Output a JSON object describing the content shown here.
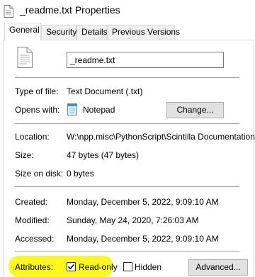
{
  "window": {
    "title": "_readme.txt Properties",
    "title_icon": "text-file-icon"
  },
  "tabs": [
    {
      "label": "General",
      "active": true
    },
    {
      "label": "Security",
      "active": false
    },
    {
      "label": "Details",
      "active": false
    },
    {
      "label": "Previous Versions",
      "active": false
    }
  ],
  "general": {
    "file_name": "_readme.txt",
    "type_label": "Type of file:",
    "type_value": "Text Document (.txt)",
    "opens_label": "Opens with:",
    "opens_value": "Notepad",
    "opens_icon": "notepad-icon",
    "change_button": "Change...",
    "location_label": "Location:",
    "location_value": "W:\\npp.misc\\PythonScript\\Scintilla Documentation",
    "size_label": "Size:",
    "size_value": "47 bytes (47 bytes)",
    "size_on_disk_label": "Size on disk:",
    "size_on_disk_value": "0 bytes",
    "created_label": "Created:",
    "created_value": "Monday, December 5, 2022, 9:09:10 AM",
    "modified_label": "Modified:",
    "modified_value": "Sunday, May 24, 2020, 7:26:03 AM",
    "accessed_label": "Accessed:",
    "accessed_value": "Monday, December 5, 2022, 9:09:10 AM",
    "attributes_label": "Attributes:",
    "readonly_label": "Read-only",
    "readonly_checked": true,
    "hidden_label": "Hidden",
    "hidden_checked": false,
    "advanced_button": "Advanced..."
  },
  "colors": {
    "highlight": "#fdf81c",
    "button_bg": "#e1e1e1",
    "separator": "#a0a0a0"
  }
}
